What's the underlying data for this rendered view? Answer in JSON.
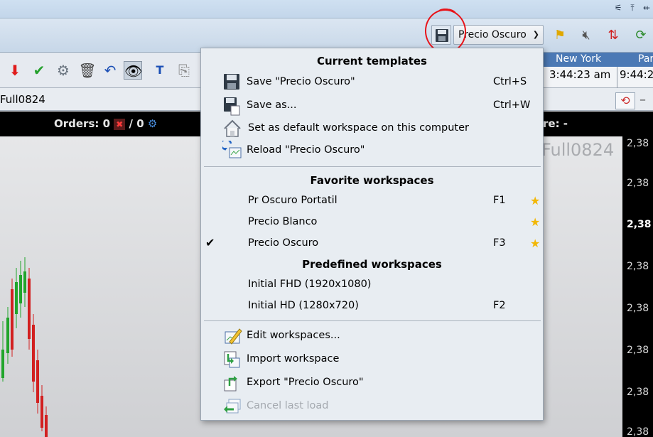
{
  "app": {
    "workspace_selector": "Precio Oscuro",
    "chart_title": "Full0824",
    "watermark": "Full0824",
    "orders_label": "Orders: 0",
    "orders_sep": "/ 0",
    "right_label": "re: -",
    "clocks": [
      {
        "city": "New York",
        "time": "3:44:23 am"
      },
      {
        "city": "Par",
        "time": "9:44:2"
      }
    ],
    "price_ticks": [
      "2,38",
      "2,38",
      "2,38",
      "2,38",
      "2,38",
      "2,38",
      "2,38",
      "2,38"
    ],
    "annotation_color": "#e8141a"
  },
  "menu": {
    "sections": {
      "current": "Current templates",
      "favorites": "Favorite workspaces",
      "predefined": "Predefined workspaces"
    },
    "current_items": [
      {
        "label": "Save \"Precio Oscuro\"",
        "shortcut": "Ctrl+S",
        "icon": "floppy-disk-icon"
      },
      {
        "label": "Save as...",
        "shortcut": "Ctrl+W",
        "icon": "save-as-icon"
      },
      {
        "label": "Set as default workspace on this computer",
        "shortcut": "",
        "icon": "home-icon"
      },
      {
        "label": "Reload \"Precio Oscuro\"",
        "shortcut": "",
        "icon": "reload-icon"
      }
    ],
    "favorite_items": [
      {
        "label": "Pr Oscuro Portatil",
        "fkey": "F1",
        "checked": false
      },
      {
        "label": "Precio Blanco",
        "fkey": "",
        "checked": false
      },
      {
        "label": "Precio Oscuro",
        "fkey": "F3",
        "checked": true
      }
    ],
    "predefined_items": [
      {
        "label": "Initial FHD (1920x1080)",
        "fkey": ""
      },
      {
        "label": "Initial HD (1280x720)",
        "fkey": "F2"
      }
    ],
    "manage_items": [
      {
        "label": "Edit workspaces...",
        "icon": "edit-workspaces-icon",
        "enabled": true
      },
      {
        "label": "Import workspace",
        "icon": "import-icon",
        "enabled": true
      },
      {
        "label": "Export \"Precio Oscuro\"",
        "icon": "export-icon",
        "enabled": true
      },
      {
        "label": "Cancel last load",
        "icon": "undo-load-icon",
        "enabled": false
      }
    ],
    "star_color": "#f2b705",
    "check_glyph": "✔"
  }
}
